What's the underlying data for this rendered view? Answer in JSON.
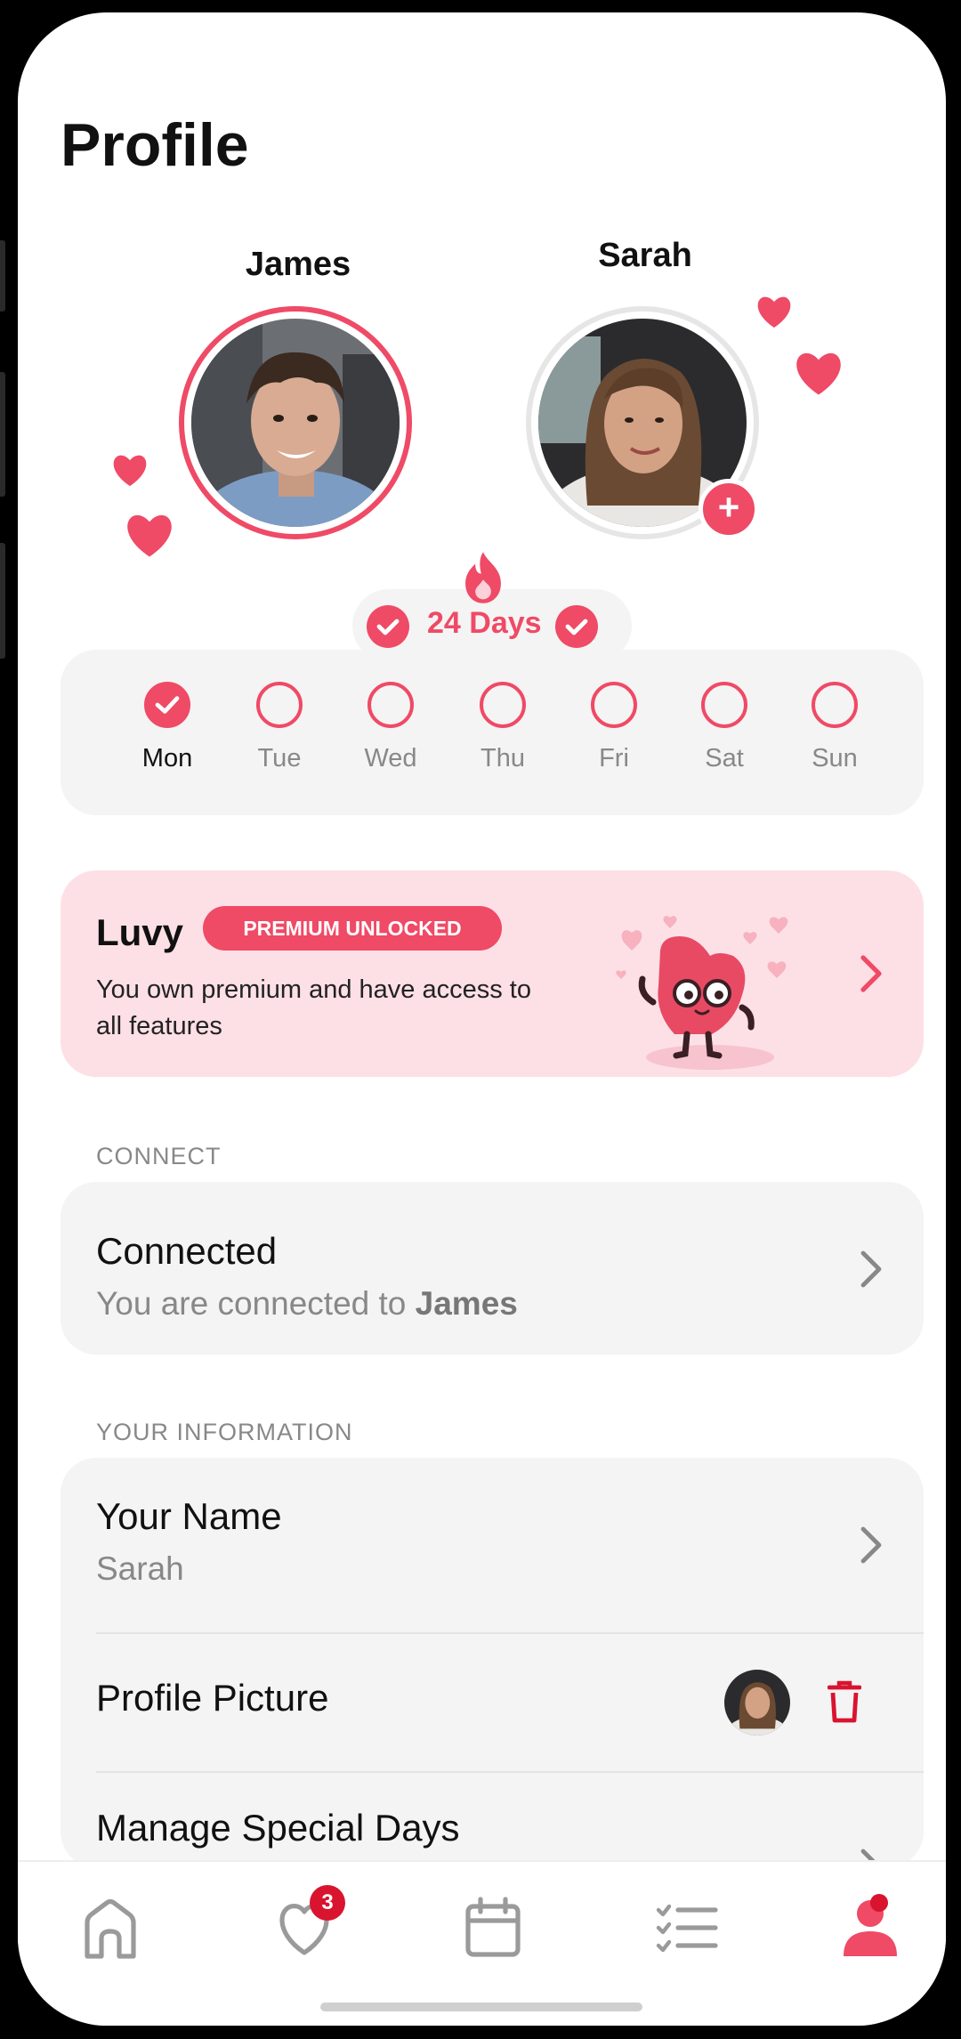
{
  "page": {
    "title": "Profile"
  },
  "partners": {
    "left": {
      "name": "James"
    },
    "right": {
      "name": "Sarah"
    }
  },
  "streak": {
    "label": "24 Days"
  },
  "week": {
    "days": [
      {
        "label": "Mon",
        "checked": true
      },
      {
        "label": "Tue",
        "checked": false
      },
      {
        "label": "Wed",
        "checked": false
      },
      {
        "label": "Thu",
        "checked": false
      },
      {
        "label": "Fri",
        "checked": false
      },
      {
        "label": "Sat",
        "checked": false
      },
      {
        "label": "Sun",
        "checked": false
      }
    ]
  },
  "premium": {
    "title": "Luvy",
    "badge": "PREMIUM UNLOCKED",
    "description": "You own premium and have access to all features"
  },
  "connect": {
    "section_label": "CONNECT",
    "title": "Connected",
    "subtitle_prefix": "You are connected to ",
    "subtitle_name": "James"
  },
  "info": {
    "section_label": "YOUR INFORMATION",
    "name_title": "Your Name",
    "name_value": "Sarah",
    "picture_title": "Profile Picture",
    "special_days_title": "Manage Special Days"
  },
  "tabbar": {
    "notification_count": "3",
    "tabs": [
      "home-icon",
      "heart-icon",
      "calendar-icon",
      "checklist-icon",
      "profile-icon"
    ]
  },
  "colors": {
    "accent": "#ef4a66",
    "card": "#f4f4f4",
    "premium_bg": "#fde0e6"
  }
}
